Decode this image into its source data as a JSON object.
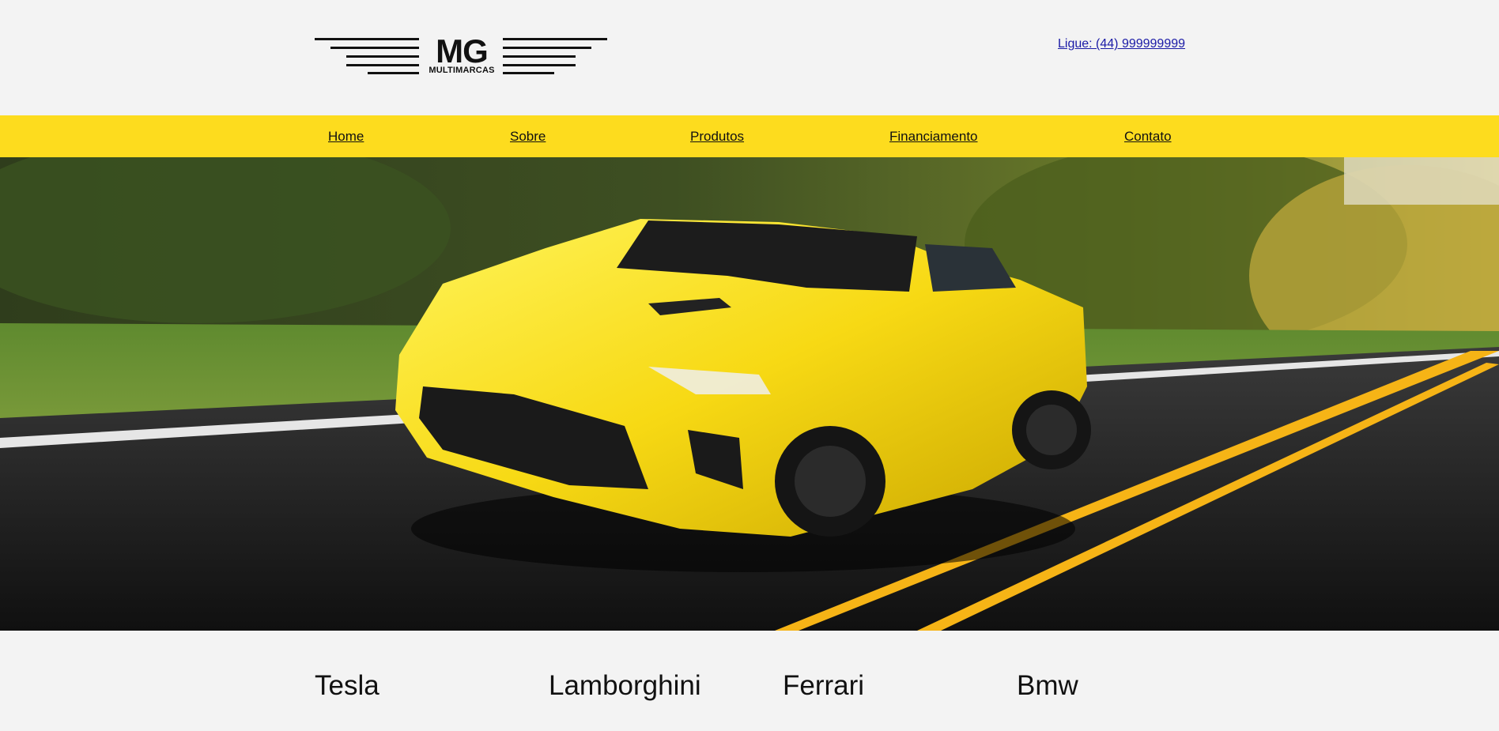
{
  "header": {
    "logo": {
      "mark": "MG",
      "subtitle": "MULTIMARCAS"
    },
    "phone_link": "Ligue: (44) 999999999"
  },
  "nav": {
    "items": [
      {
        "label": "Home"
      },
      {
        "label": "Sobre"
      },
      {
        "label": "Produtos"
      },
      {
        "label": "Financiamento"
      },
      {
        "label": "Contato"
      }
    ]
  },
  "hero": {
    "image": "yellow-sports-car-on-road-photo"
  },
  "brands": {
    "items": [
      {
        "label": "Tesla"
      },
      {
        "label": "Lamborghini"
      },
      {
        "label": "Ferrari"
      },
      {
        "label": "Bmw"
      }
    ]
  },
  "colors": {
    "background": "#f3f3f3",
    "nav_bar": "#fddc1e",
    "link": "#1a1aa6",
    "text": "#111111"
  }
}
